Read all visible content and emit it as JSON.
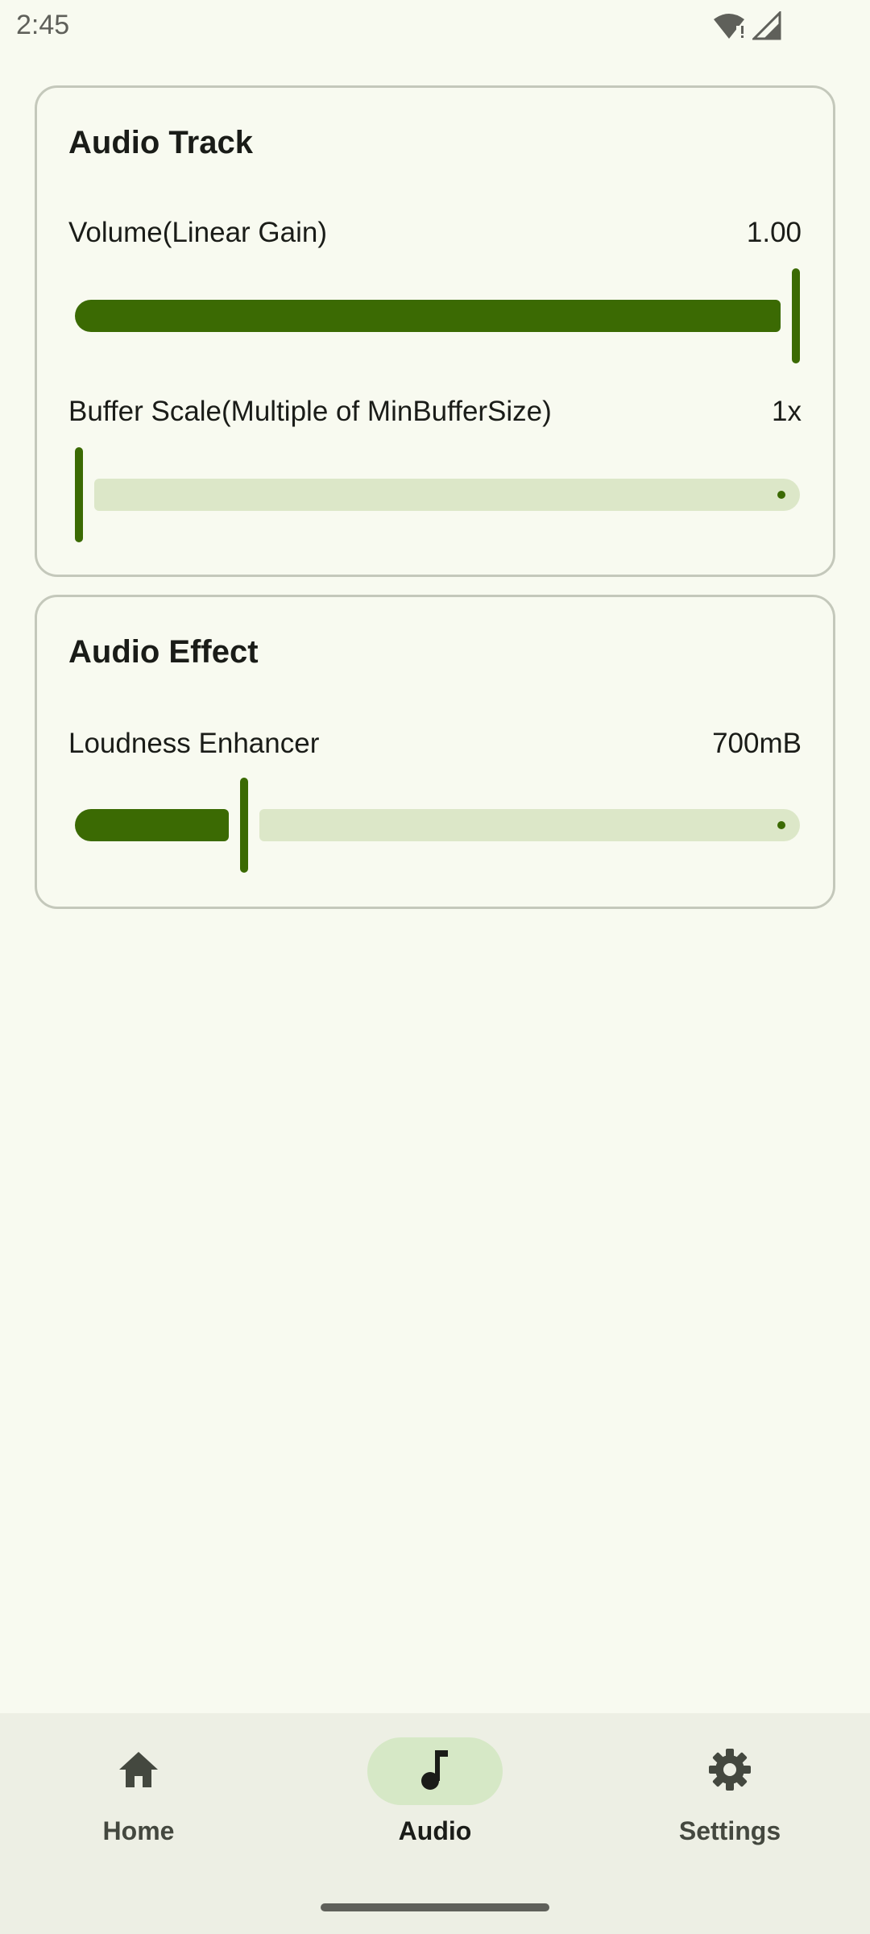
{
  "status_bar": {
    "time": "2:45",
    "icons": [
      "wifi-alert-icon",
      "cell-signal-icon"
    ]
  },
  "audio_track": {
    "title": "Audio Track",
    "volume": {
      "label": "Volume(Linear Gain)",
      "value": "1.00",
      "fraction": 1.0
    },
    "buffer_scale": {
      "label": "Buffer Scale(Multiple of MinBufferSize)",
      "value": "1x",
      "fraction": 0.0
    }
  },
  "audio_effect": {
    "title": "Audio Effect",
    "loudness": {
      "label": "Loudness Enhancer",
      "value": "700mB",
      "fraction": 0.23
    }
  },
  "nav": {
    "items": [
      {
        "label": "Home",
        "icon": "home-icon",
        "active": false
      },
      {
        "label": "Audio",
        "icon": "music-note-icon",
        "active": true
      },
      {
        "label": "Settings",
        "icon": "gear-icon",
        "active": false
      }
    ]
  },
  "colors": {
    "primary": "#3b6a03",
    "track_inactive": "#dce7c8",
    "background": "#f8faf0",
    "nav_background": "#edefe4",
    "nav_active_pill": "#d6e8c6"
  }
}
